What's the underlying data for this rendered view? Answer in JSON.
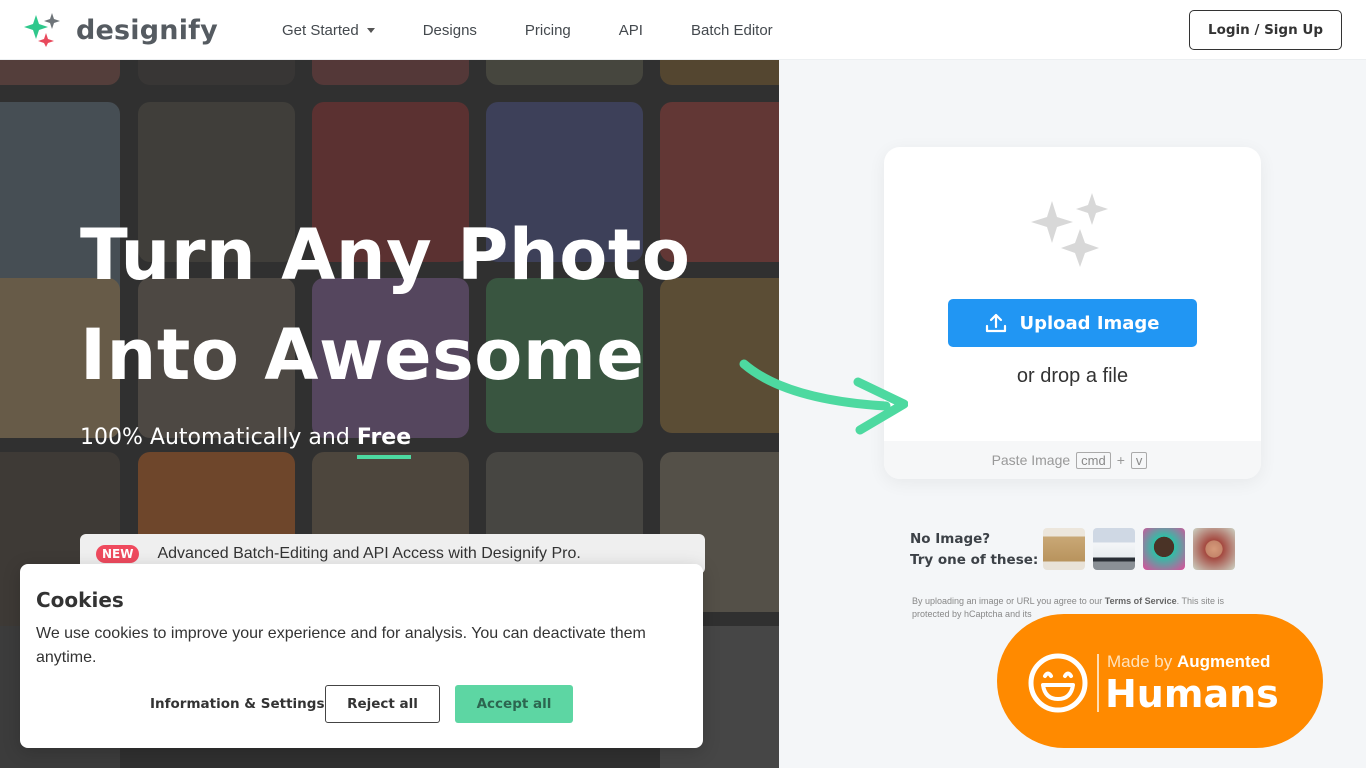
{
  "header": {
    "logo_text": "designify",
    "nav": [
      {
        "label": "Get Started",
        "has_dropdown": true
      },
      {
        "label": "Designs"
      },
      {
        "label": "Pricing"
      },
      {
        "label": "API"
      },
      {
        "label": "Batch Editor"
      }
    ],
    "login_label": "Login / Sign Up"
  },
  "hero": {
    "headline_line1": "Turn Any Photo",
    "headline_line2": "Into Awesome",
    "subline_prefix": "100% Automatically and ",
    "subline_emphasis": "Free",
    "new_badge": "NEW",
    "new_text": "Advanced Batch-Editing and API Access with Designify Pro."
  },
  "cookie": {
    "title": "Cookies",
    "text": "We use cookies to improve your experience and for analysis. You can deactivate them anytime.",
    "info_label": "Information & Settings",
    "reject_label": "Reject all",
    "accept_label": "Accept all"
  },
  "upload": {
    "button_label": "Upload Image",
    "drop_text": "or drop a file",
    "paste_label": "Paste Image",
    "key_cmd": "cmd",
    "key_plus": "+",
    "key_v": "v"
  },
  "samples": {
    "label_line1": "No Image?",
    "label_line2": "Try one of these:",
    "items": [
      "cup",
      "car",
      "person",
      "woman"
    ]
  },
  "terms": {
    "prefix": "By uploading an image or URL you agree to our ",
    "link": "Terms of Service",
    "suffix": ". This site is protected by hCaptcha and its"
  },
  "badge": {
    "small_prefix": "Made by ",
    "small_bold": "Augmented",
    "big": "Humans"
  },
  "colors": {
    "accent_green": "#4dd9a0",
    "upload_blue": "#2196f3",
    "new_red": "#ef4a5e",
    "badge_orange": "#ff8a00"
  }
}
